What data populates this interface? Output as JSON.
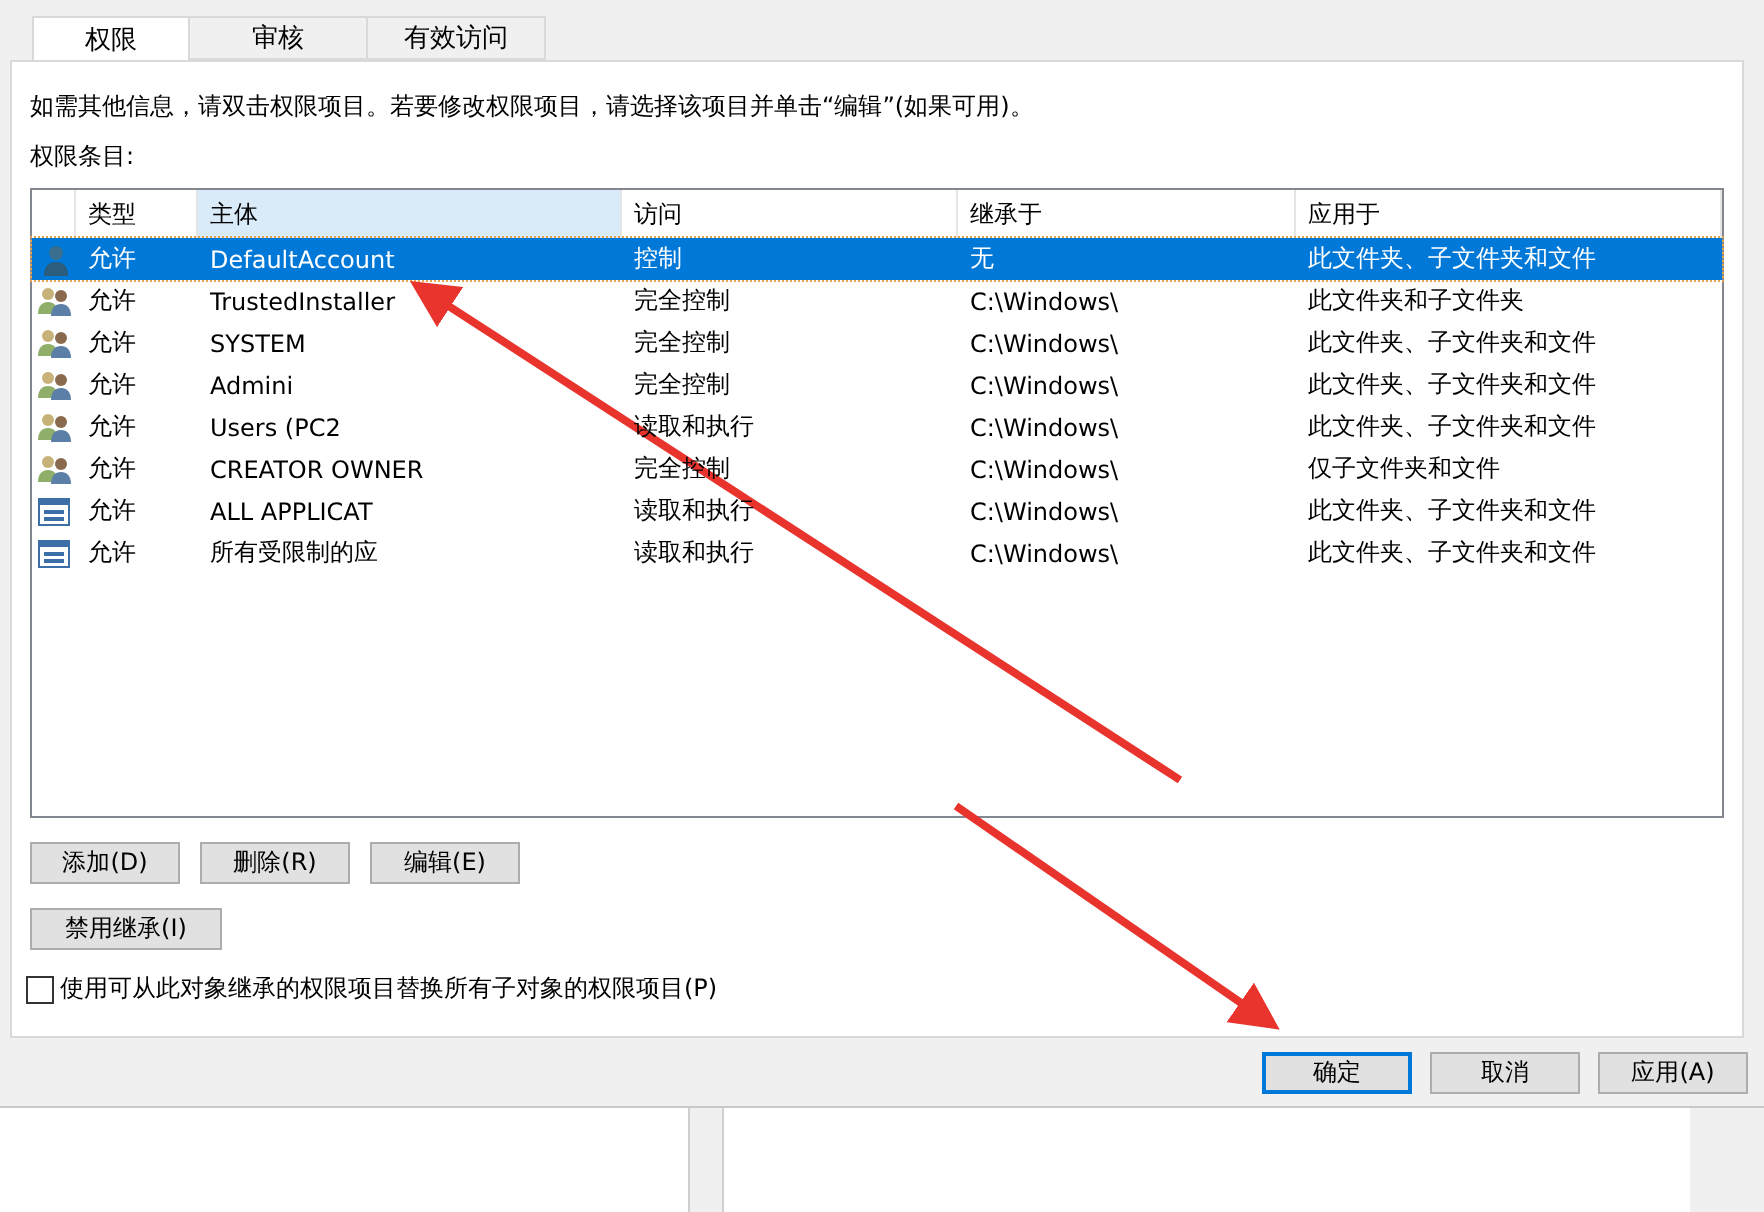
{
  "tabs": [
    {
      "label": "权限",
      "selected": true
    },
    {
      "label": "审核",
      "selected": false
    },
    {
      "label": "有效访问",
      "selected": false
    }
  ],
  "info_text": "如需其他信息，请双击权限项目。若要修改权限项目，请选择该项目并单击“编辑”(如果可用)。",
  "list_label": "权限条目:",
  "table": {
    "columns": [
      {
        "label": "类型",
        "highlighted": false
      },
      {
        "label": "主体",
        "highlighted": true
      },
      {
        "label": "访问",
        "highlighted": false
      },
      {
        "label": "继承于",
        "highlighted": false
      },
      {
        "label": "应用于",
        "highlighted": false
      }
    ],
    "rows": [
      {
        "kind": "user",
        "selected": true,
        "cells": [
          "允许",
          "DefaultAccount",
          "控制",
          "无",
          "此文件夹、子文件夹和文件"
        ]
      },
      {
        "kind": "group",
        "selected": false,
        "cells": [
          "允许",
          "TrustedInstaller",
          "完全控制",
          "C:\\Windows\\",
          "此文件夹和子文件夹"
        ]
      },
      {
        "kind": "group",
        "selected": false,
        "cells": [
          "允许",
          "SYSTEM",
          "完全控制",
          "C:\\Windows\\",
          "此文件夹、子文件夹和文件"
        ]
      },
      {
        "kind": "group",
        "selected": false,
        "cells": [
          "允许",
          "Admini",
          "完全控制",
          "C:\\Windows\\",
          "此文件夹、子文件夹和文件"
        ]
      },
      {
        "kind": "group",
        "selected": false,
        "cells": [
          "允许",
          "Users (PC2",
          "读取和执行",
          "C:\\Windows\\",
          "此文件夹、子文件夹和文件"
        ]
      },
      {
        "kind": "group",
        "selected": false,
        "cells": [
          "允许",
          "CREATOR OWNER",
          "完全控制",
          "C:\\Windows\\",
          "仅子文件夹和文件"
        ]
      },
      {
        "kind": "package",
        "selected": false,
        "cells": [
          "允许",
          "ALL APPLICAT",
          "读取和执行",
          "C:\\Windows\\",
          "此文件夹、子文件夹和文件"
        ]
      },
      {
        "kind": "package",
        "selected": false,
        "cells": [
          "允许",
          "所有受限制的应",
          "读取和执行",
          "C:\\Windows\\",
          "此文件夹、子文件夹和文件"
        ]
      }
    ]
  },
  "entry_buttons": [
    "添加(D)",
    "删除(R)",
    "编辑(E)"
  ],
  "inherit_button": "禁用继承(I)",
  "replace_option": {
    "label": "使用可从此对象继承的权限项目替换所有子对象的权限项目(P)",
    "checked": false
  },
  "dialog_buttons": [
    {
      "label": "确定",
      "focused": true
    },
    {
      "label": "取消",
      "focused": false
    },
    {
      "label": "应用(A)",
      "focused": false
    }
  ]
}
